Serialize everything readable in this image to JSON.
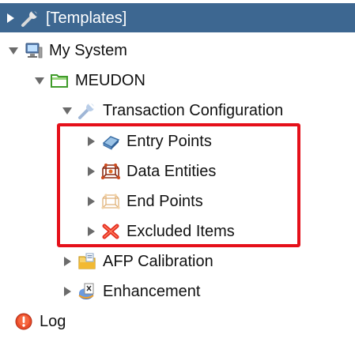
{
  "tree": {
    "nodes": [
      {
        "label": "[Templates]",
        "icon": "wrench-icon",
        "expander": "collapsed"
      },
      {
        "label": "My System",
        "icon": "computer-icon",
        "expander": "expanded"
      },
      {
        "label": "MEUDON",
        "icon": "folder-icon",
        "expander": "expanded"
      },
      {
        "label": "Transaction Configuration",
        "icon": "wrench-icon",
        "expander": "expanded"
      },
      {
        "label": "Entry Points",
        "icon": "entry-points-icon",
        "expander": "collapsed"
      },
      {
        "label": "Data Entities",
        "icon": "data-entities-icon",
        "expander": "collapsed"
      },
      {
        "label": "End Points",
        "icon": "end-points-icon",
        "expander": "collapsed"
      },
      {
        "label": "Excluded Items",
        "icon": "excluded-x-icon",
        "expander": "collapsed"
      },
      {
        "label": "AFP Calibration",
        "icon": "afp-calibration-icon",
        "expander": "collapsed"
      },
      {
        "label": "Enhancement",
        "icon": "enhancement-icon",
        "expander": "collapsed"
      },
      {
        "label": "Log",
        "icon": "log-alert-icon",
        "expander": "none"
      }
    ]
  },
  "colors": {
    "selected_row_bg": "#3d6791",
    "highlight_border": "#e5101a",
    "expander": "#6b6b6b"
  }
}
